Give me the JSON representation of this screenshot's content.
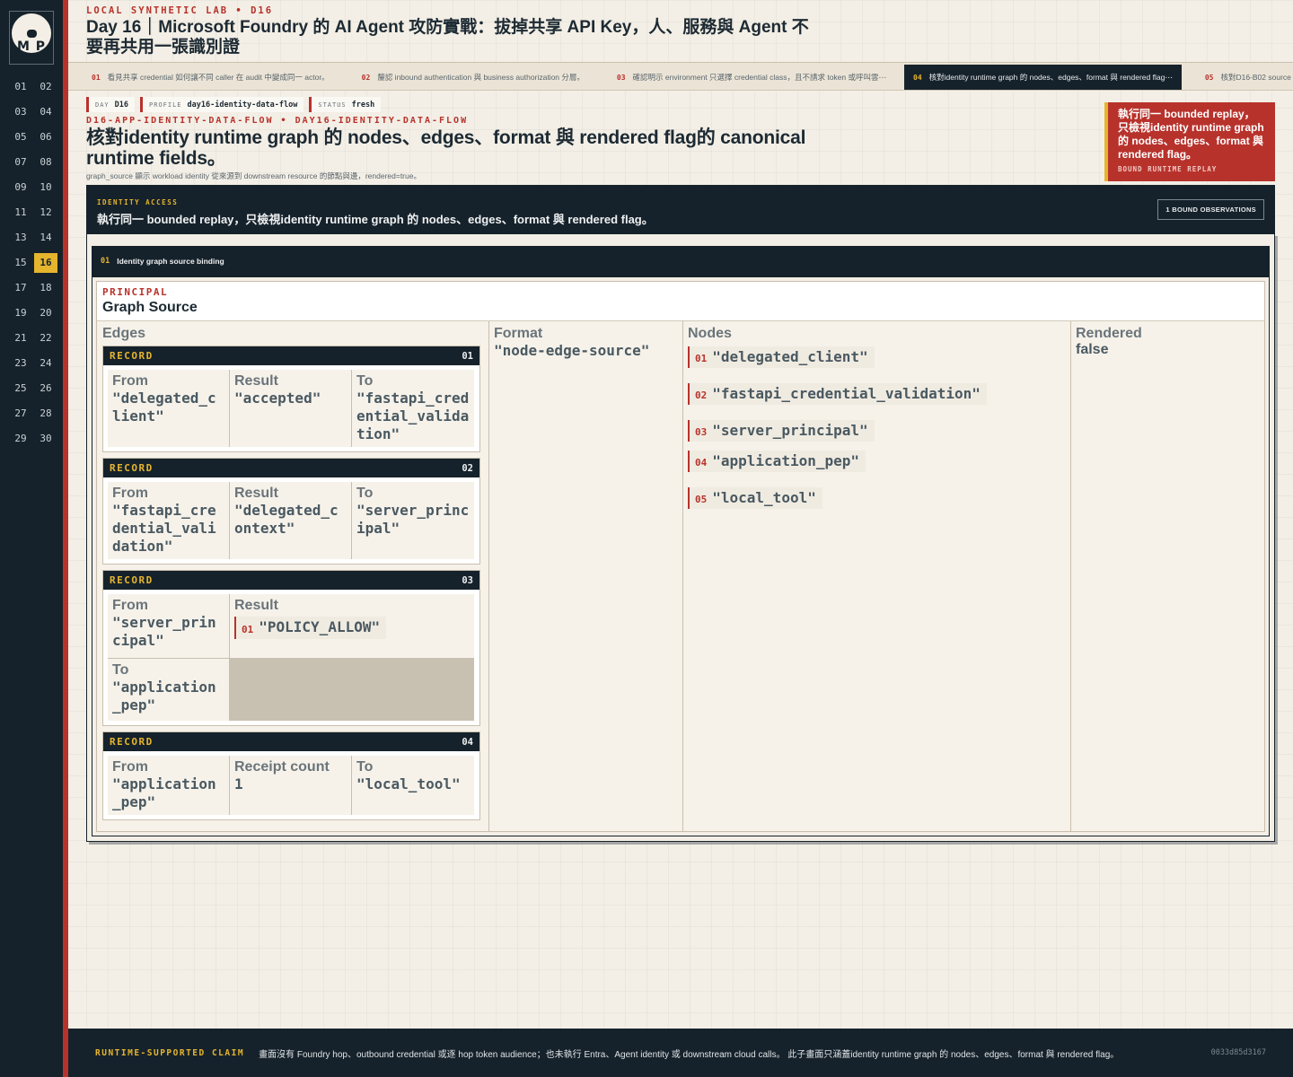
{
  "logo": {
    "initials": "M P"
  },
  "sidebar": {
    "days": [
      "01",
      "02",
      "03",
      "04",
      "05",
      "06",
      "07",
      "08",
      "09",
      "10",
      "11",
      "12",
      "13",
      "14",
      "15",
      "16",
      "17",
      "18",
      "19",
      "20",
      "21",
      "22",
      "23",
      "24",
      "25",
      "26",
      "27",
      "28",
      "29",
      "30"
    ],
    "active_day": "16"
  },
  "header": {
    "kicker": "LOCAL SYNTHETIC LAB  •  D16",
    "title": "Day 16｜Microsoft Foundry 的 AI Agent 攻防實戰：拔掉共享 API Key，人、服務與 Agent 不要再共用一張識別證"
  },
  "tabs": [
    {
      "num": "01",
      "label": "看見共享 credential 如何讓不同 caller 在 audit 中變成同一 actor。",
      "active": false
    },
    {
      "num": "02",
      "label": "釐認 inbound authentication 與 business authorization 分層。",
      "active": false
    },
    {
      "num": "03",
      "label": "確認明示 environment 只選擇 credential class，且不請求 token 或呼叫雲⋯",
      "active": false
    },
    {
      "num": "04",
      "label": "核對identity runtime graph 的 nodes、edges、format 與 rendered flag⋯",
      "active": true
    },
    {
      "num": "05",
      "label": "核對D16-B02 source outcome 的 status",
      "active": false
    }
  ],
  "meta": [
    {
      "key": "DAY",
      "value": "D16"
    },
    {
      "key": "PROFILE",
      "value": "day16-identity-data-flow"
    },
    {
      "key": "STATUS",
      "value": "fresh"
    }
  ],
  "section": {
    "kicker": "D16-APP-IDENTITY-DATA-FLOW  •  DAY16-IDENTITY-DATA-FLOW",
    "title": "核對identity runtime graph 的 nodes、edges、format 與 rendered flag的 canonical runtime fields。",
    "description": "graph_source 顯示 workload identity 從來源到 downstream resource 的節點與邊，rendered=true。"
  },
  "callout": {
    "text": "執行同一 bounded replay，只檢視identity runtime graph 的 nodes、edges、format 與 rendered flag。",
    "label": "BOUND RUNTIME REPLAY"
  },
  "banner": {
    "kicker": "IDENTITY ACCESS",
    "text": "執行同一 bounded replay，只檢視identity runtime graph 的 nodes、edges、format 與 rendered flag。",
    "badge": "1 BOUND OBSERVATIONS"
  },
  "observation": {
    "num": "01",
    "title": "Identity graph source binding",
    "principal_key": "PRINCIPAL",
    "principal_value": "Graph Source",
    "labels": {
      "edges": "Edges",
      "format": "Format",
      "nodes": "Nodes",
      "rendered": "Rendered",
      "record": "RECORD",
      "from": "From",
      "result": "Result",
      "to": "To",
      "receipt_count": "Receipt count"
    },
    "format_value": "\"node-edge-source\"",
    "rendered_value": "false",
    "records": [
      {
        "num": "01",
        "from": "\"delegated_client\"",
        "result": "\"accepted\"",
        "to": "\"fastapi_credential_validation\""
      },
      {
        "num": "02",
        "from": "\"fastapi_credential_validation\"",
        "result": "\"delegated_context\"",
        "to": "\"server_principal\""
      },
      {
        "num": "03",
        "from": "\"server_principal\"",
        "result_item_index": "01",
        "result_item": "\"POLICY_ALLOW\"",
        "to": "\"application_pep\""
      },
      {
        "num": "04",
        "from": "\"application_pep\"",
        "receipt_count": "1",
        "to": "\"local_tool\""
      }
    ],
    "nodes": [
      {
        "i": "01",
        "v": "\"delegated_client\""
      },
      {
        "i": "02",
        "v": "\"fastapi_credential_validation\""
      },
      {
        "i": "03",
        "v": "\"server_principal\""
      },
      {
        "i": "04",
        "v": "\"application_pep\""
      },
      {
        "i": "05",
        "v": "\"local_tool\""
      }
    ]
  },
  "footer": {
    "kicker": "RUNTIME-SUPPORTED CLAIM",
    "text": "畫面沒有 Foundry hop、outbound credential 或逐 hop token audience；也未執行 Entra、Agent identity 或 downstream cloud calls。 此子畫面只涵蓋identity runtime graph 的 nodes、edges、format 與 rendered flag。",
    "hash": "0033d85d3167"
  },
  "colors": {
    "accent_red": "#b8322c",
    "accent_gold": "#e5b52e",
    "ink": "#16222b"
  }
}
